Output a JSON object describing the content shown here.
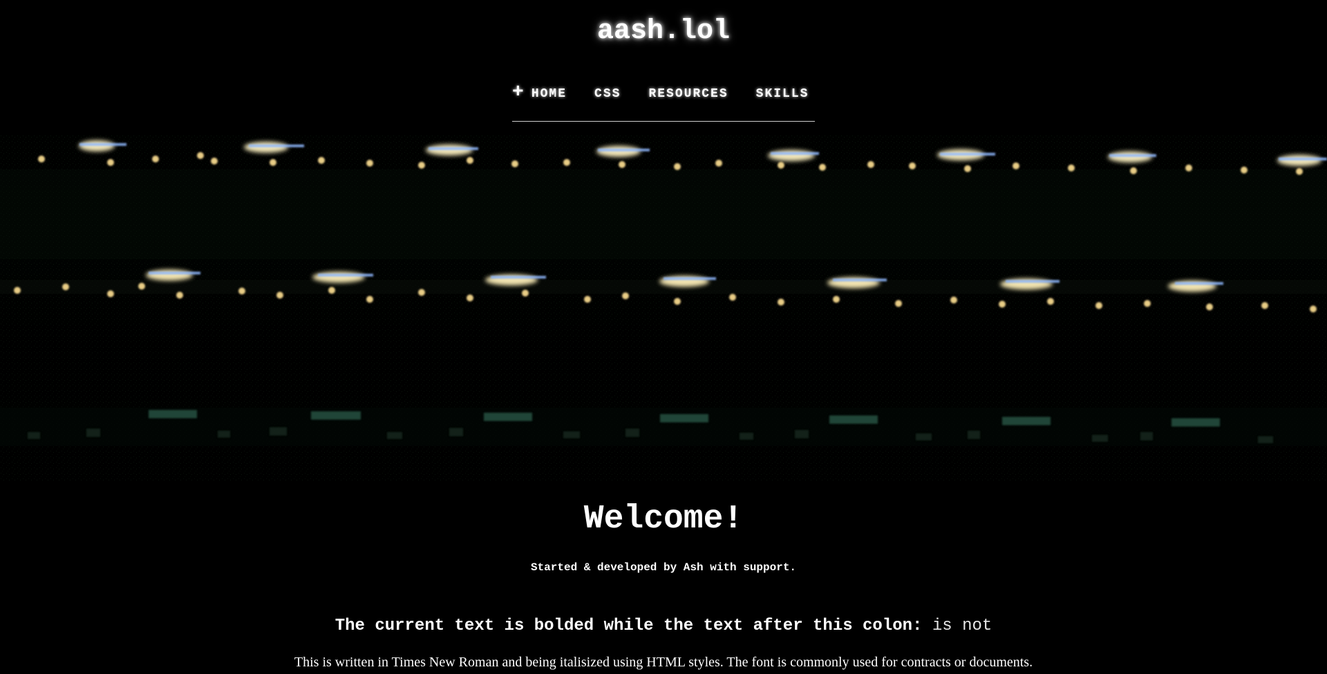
{
  "site": {
    "title": "aash.lol"
  },
  "nav": {
    "active_icon": "plus-icon",
    "items": [
      {
        "label": "HOME"
      },
      {
        "label": "CSS"
      },
      {
        "label": "RESOURCES"
      },
      {
        "label": "SKILLS"
      }
    ]
  },
  "hero": {
    "image": "dark-city-lights-image"
  },
  "content": {
    "welcome": "Welcome!",
    "subtitle": "Started & developed by Ash with support.",
    "bold_text": "The current text is bolded while the text after this colon:",
    "normal_text": "is not",
    "serif_text": "This is written in Times New Roman and being italisized using HTML styles. The font is commonly used for contracts or documents."
  },
  "colors": {
    "background": "#000000",
    "text": "#ffffff",
    "nav_rule": "#cfcfcf",
    "light_warm": "#f5e6b0",
    "light_cool": "#88b7ff",
    "light_green": "#2e8f74"
  }
}
